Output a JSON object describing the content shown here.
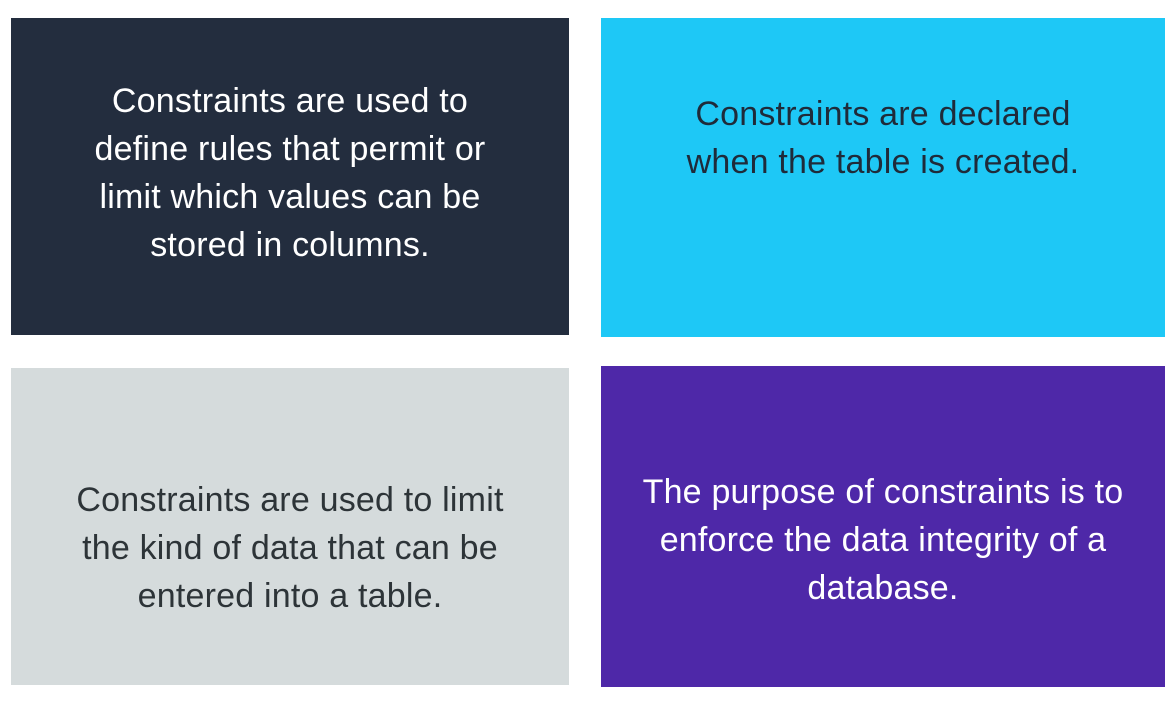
{
  "cards": [
    {
      "text": "Constraints are used to\ndefine rules that permit or\nlimit which values can be\nstored in columns.",
      "color": "#232d3e"
    },
    {
      "text": "Constraints are declared\nwhen the table is created.",
      "color": "#1ec8f6"
    },
    {
      "text": "Constraints are used to limit\nthe kind of data that can be\nentered into a table.",
      "color": "#d5dbdc"
    },
    {
      "text": "The purpose of constraints is to\nenforce the data integrity of a\ndatabase.",
      "color": "#4e28a8"
    }
  ]
}
